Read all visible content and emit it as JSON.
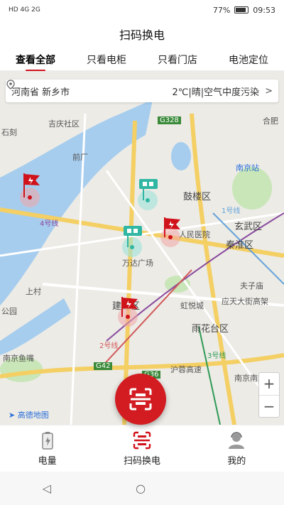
{
  "status_bar": {
    "left": "HD 4G 2G",
    "battery_percent": "77%",
    "time": "09:53"
  },
  "title": "扫码换电",
  "tabs": [
    {
      "label": "查看全部",
      "active": true
    },
    {
      "label": "只看电柜",
      "active": false
    },
    {
      "label": "只看门店",
      "active": false
    },
    {
      "label": "电池定位",
      "active": false
    }
  ],
  "location_bar": {
    "city": "河南省 新乡市",
    "weather": "2℃|晴|空气中度污染",
    "arrow": ">"
  },
  "map": {
    "labels": [
      "吉庆社区",
      "前厂",
      "G328",
      "合肥",
      "南京站",
      "鼓楼区",
      "玄武区",
      "秦淮区",
      "人民医院",
      "万达广场",
      "夫子庙",
      "应天大街高架",
      "虹悦城",
      "雨花台区",
      "建邺区",
      "南京鱼嘴",
      "G42",
      "G36",
      "沪蓉高速",
      "南京南站",
      "公园",
      "上村",
      "石刻",
      "1号线",
      "2号线",
      "3号线",
      "4号线"
    ],
    "logo": "高德地图",
    "zoom_in": "+",
    "zoom_out": "−"
  },
  "bottom_nav": [
    {
      "label": "电量",
      "icon": "battery-icon"
    },
    {
      "label": "扫码换电",
      "icon": "scan-icon"
    },
    {
      "label": "我的",
      "icon": "user-icon"
    }
  ],
  "system_nav": {
    "back": "◁",
    "home": "○"
  },
  "colors": {
    "accent": "#d0121b",
    "teal_marker": "#3cc6b3",
    "water": "#9fc8ea",
    "park": "#c8e6b7",
    "road": "#f7cf5f"
  }
}
